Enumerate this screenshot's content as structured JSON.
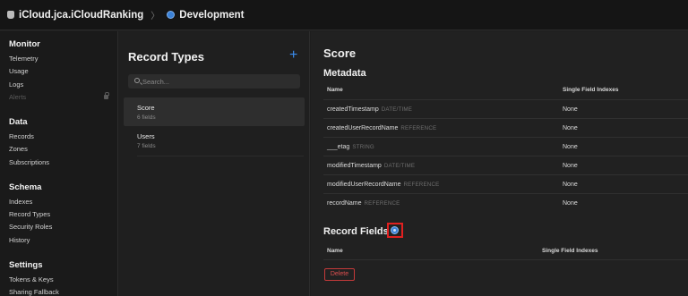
{
  "topbar": {
    "container": "iCloud.jca.iCloudRanking",
    "separator": "〉",
    "environment": "Development"
  },
  "sidebar": {
    "sections": [
      {
        "title": "Monitor",
        "items": [
          "Telemetry",
          "Usage",
          "Logs",
          "Alerts"
        ]
      },
      {
        "title": "Data",
        "items": [
          "Records",
          "Zones",
          "Subscriptions"
        ]
      },
      {
        "title": "Schema",
        "items": [
          "Indexes",
          "Record Types",
          "Security Roles",
          "History"
        ]
      },
      {
        "title": "Settings",
        "items": [
          "Tokens & Keys",
          "Sharing Fallback"
        ]
      }
    ]
  },
  "record_types": {
    "title": "Record Types",
    "add_label": "+",
    "search_placeholder": "Search...",
    "items": [
      {
        "name": "Score",
        "count": "6 fields"
      },
      {
        "name": "Users",
        "count": "7 fields"
      }
    ]
  },
  "detail": {
    "title": "Score",
    "metadata_title": "Metadata",
    "col_name": "Name",
    "col_index": "Single Field Indexes",
    "metadata_rows": [
      {
        "name": "createdTimestamp",
        "type": "DATE/TIME",
        "index": "None"
      },
      {
        "name": "createdUserRecordName",
        "type": "REFERENCE",
        "index": "None"
      },
      {
        "name": "___etag",
        "type": "STRING",
        "index": "None"
      },
      {
        "name": "modifiedTimestamp",
        "type": "DATE/TIME",
        "index": "None"
      },
      {
        "name": "modifiedUserRecordName",
        "type": "REFERENCE",
        "index": "None"
      },
      {
        "name": "recordName",
        "type": "REFERENCE",
        "index": "None"
      }
    ],
    "record_fields_title": "Record Fields",
    "rf_col_name": "Name",
    "rf_col_index": "Single Field Indexes",
    "delete_label": "Delete"
  }
}
